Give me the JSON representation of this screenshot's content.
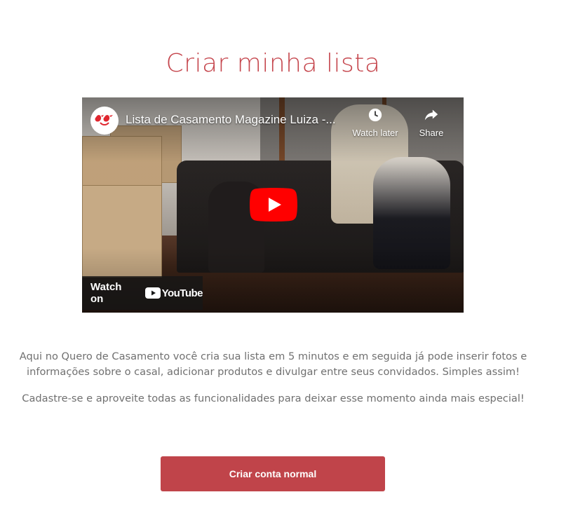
{
  "page": {
    "title": "Criar minha lista"
  },
  "video": {
    "title": "Lista de Casamento Magazine Luiza -...",
    "channel_icon": "magazine-luiza-birds-logo",
    "watch_later_label": "Watch later",
    "share_label": "Share",
    "watch_on_label": "Watch on",
    "youtube_label": "YouTube",
    "icons": {
      "watch_later": "clock-icon",
      "share": "share-arrow-icon",
      "play": "youtube-play-icon"
    }
  },
  "description": {
    "paragraph1": "Aqui no Quero de Casamento você cria sua lista em 5 minutos e em seguida já pode inserir fotos e informações sobre o casal, adicionar produtos e divulgar entre seus convidados. Simples assim!",
    "paragraph2": "Cadastre-se e aproveite todas as funcionalidades para deixar esse momento ainda mais especial!"
  },
  "cta": {
    "label": "Criar conta normal"
  },
  "colors": {
    "brand": "#c5464d",
    "button": "#c0444a",
    "text": "#707070",
    "youtube_red": "#ff0000"
  }
}
